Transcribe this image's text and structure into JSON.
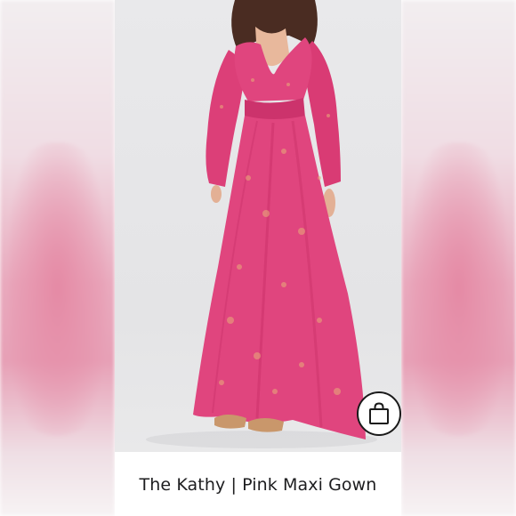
{
  "listing": {
    "title": "The Kathy | Pink Maxi Gown",
    "photo_alt": "Model wearing a long-sleeve pink maxi gown",
    "action_icon": "shopping-bag-icon"
  },
  "colors": {
    "dress": "#e0457e",
    "dress_shadow": "#c83068",
    "backdrop": "#e6e6e8",
    "side_blur": "#e8a0b6"
  }
}
